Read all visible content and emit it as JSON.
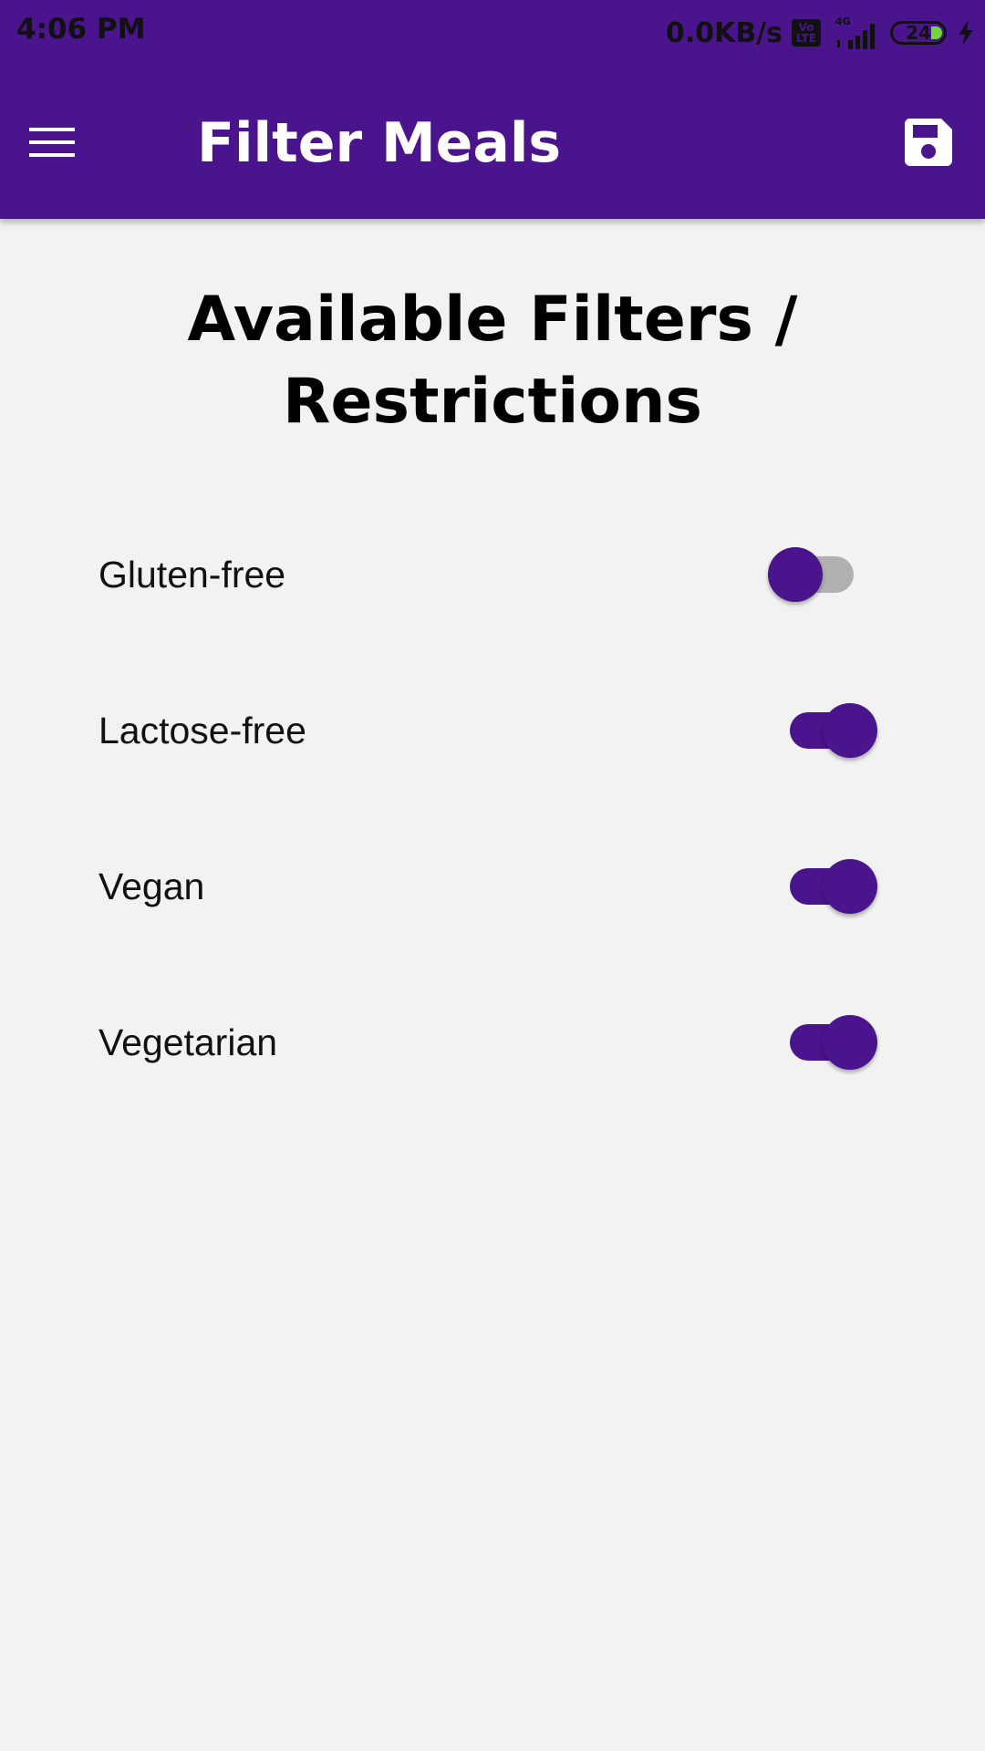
{
  "status_bar": {
    "time": "4:06 PM",
    "net_speed": "0.0KB/s",
    "volte_top": "Vo",
    "volte_bottom": "LTE",
    "network": "4G",
    "battery": "24"
  },
  "app_bar": {
    "title": "Filter Meals",
    "menu_icon": "hamburger-menu-icon",
    "save_icon": "floppy-disk-save-icon"
  },
  "main": {
    "heading": "Available Filters / Restrictions",
    "filters": [
      {
        "label": "Gluten-free",
        "enabled": false
      },
      {
        "label": "Lactose-free",
        "enabled": true
      },
      {
        "label": "Vegan",
        "enabled": true
      },
      {
        "label": "Vegetarian",
        "enabled": true
      }
    ]
  },
  "colors": {
    "primary": "#4a148c",
    "background": "#f2f2f2",
    "switch_track_off": "#b0b0b0",
    "battery_fill": "#76d43f"
  }
}
